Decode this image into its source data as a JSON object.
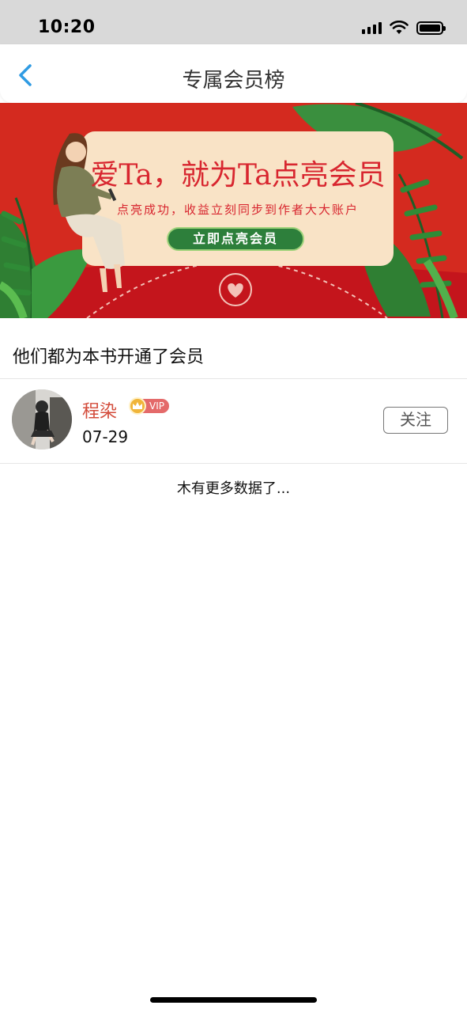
{
  "status_bar": {
    "time": "10:20"
  },
  "nav": {
    "title": "专属会员榜"
  },
  "banner": {
    "headline": "爱Ta，就为Ta点亮会员",
    "subline": "点亮成功，收益立刻同步到作者大大账户",
    "cta_label": "立即点亮会员",
    "colors": {
      "background": "#d42a1f",
      "card": "#f9e3c6",
      "cta": "#2d7f3b"
    }
  },
  "section": {
    "title": "他们都为本书开通了会员"
  },
  "members": [
    {
      "name": "程染",
      "badge": "VIP",
      "date": "07-29",
      "follow_label": "关注"
    }
  ],
  "footer": {
    "no_more_text": "木有更多数据了..."
  },
  "icons": [
    "signal-icon",
    "wifi-icon",
    "battery-icon",
    "back-chevron-icon",
    "crown-icon",
    "heart-seal-icon"
  ]
}
